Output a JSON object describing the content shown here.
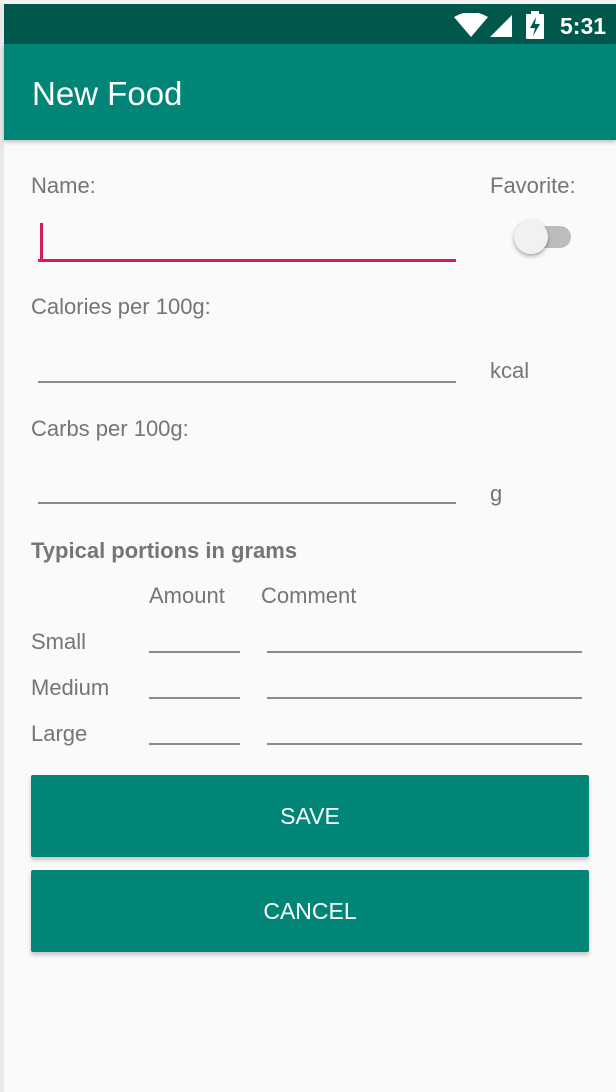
{
  "status_bar": {
    "time": "5:31",
    "icons": [
      "wifi-icon",
      "cell-signal-icon",
      "battery-charging-icon"
    ]
  },
  "app_bar": {
    "title": "New Food"
  },
  "form": {
    "name_label": "Name:",
    "name_value": "",
    "favorite_label": "Favorite:",
    "favorite_on": false,
    "calories_label": "Calories per 100g:",
    "calories_unit": "kcal",
    "carbs_label": "Carbs per 100g:",
    "carbs_unit": "g"
  },
  "portions": {
    "heading": "Typical portions in grams",
    "col_amount": "Amount",
    "col_comment": "Comment",
    "rows": [
      {
        "label": "Small"
      },
      {
        "label": "Medium"
      },
      {
        "label": "Large"
      }
    ]
  },
  "buttons": {
    "save": "SAVE",
    "cancel": "CANCEL"
  },
  "colors": {
    "primary": "#008577",
    "primary_dark": "#00574b",
    "accent": "#d81b60"
  }
}
